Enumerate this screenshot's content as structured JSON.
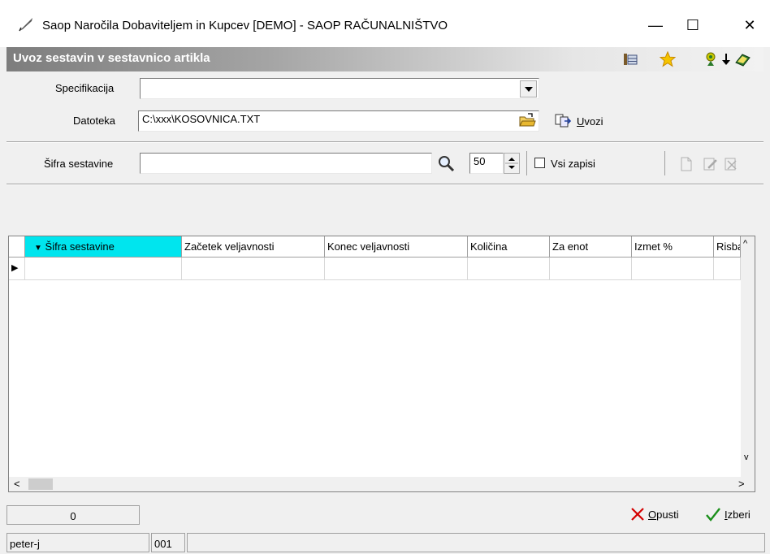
{
  "window": {
    "title": "Saop  Naročila Dobaviteljem in Kupcev [DEMO] - SAOP RAČUNALNIŠTVO",
    "minimize_glyph": "—",
    "maximize_glyph": "☐",
    "close_glyph": "✕"
  },
  "header": {
    "title": "Uvoz sestavin v sestavnico artikla"
  },
  "form": {
    "specifikacija_label": "Specifikacija",
    "specifikacija_value": "",
    "datoteka_label": "Datoteka",
    "datoteka_value": "C:\\xxx\\KOSOVNICA.TXT",
    "uvozi_label_underlined": "U",
    "uvozi_label_rest": "vozi"
  },
  "filter": {
    "sifra_label": "Šifra sestavine",
    "sifra_value": "",
    "page_size": "50",
    "vsi_zapisi_label": "Vsi zapisi",
    "vsi_zapisi_checked": false
  },
  "grid": {
    "columns": [
      {
        "label": "Šifra sestavine",
        "sort_glyph": "▼"
      },
      {
        "label": "Začetek veljavnosti"
      },
      {
        "label": "Konec veljavnosti"
      },
      {
        "label": "Količina"
      },
      {
        "label": "Za enot"
      },
      {
        "label": "Izmet %"
      },
      {
        "label": "Risba"
      }
    ],
    "row_indicator": "▶",
    "scroll_up": "^",
    "scroll_down": "v",
    "scroll_left": "<",
    "scroll_right": ">"
  },
  "footer": {
    "record_count": "0",
    "opusti_underlined": "O",
    "opusti_rest": "pusti",
    "izberi_underlined": "I",
    "izberi_rest": "zberi"
  },
  "status": {
    "user": "peter-j",
    "code": "001",
    "extra": ""
  },
  "colors": {
    "active_header": "#00e5ee",
    "cancel_red": "#d40000",
    "ok_green": "#1a8f1a"
  }
}
